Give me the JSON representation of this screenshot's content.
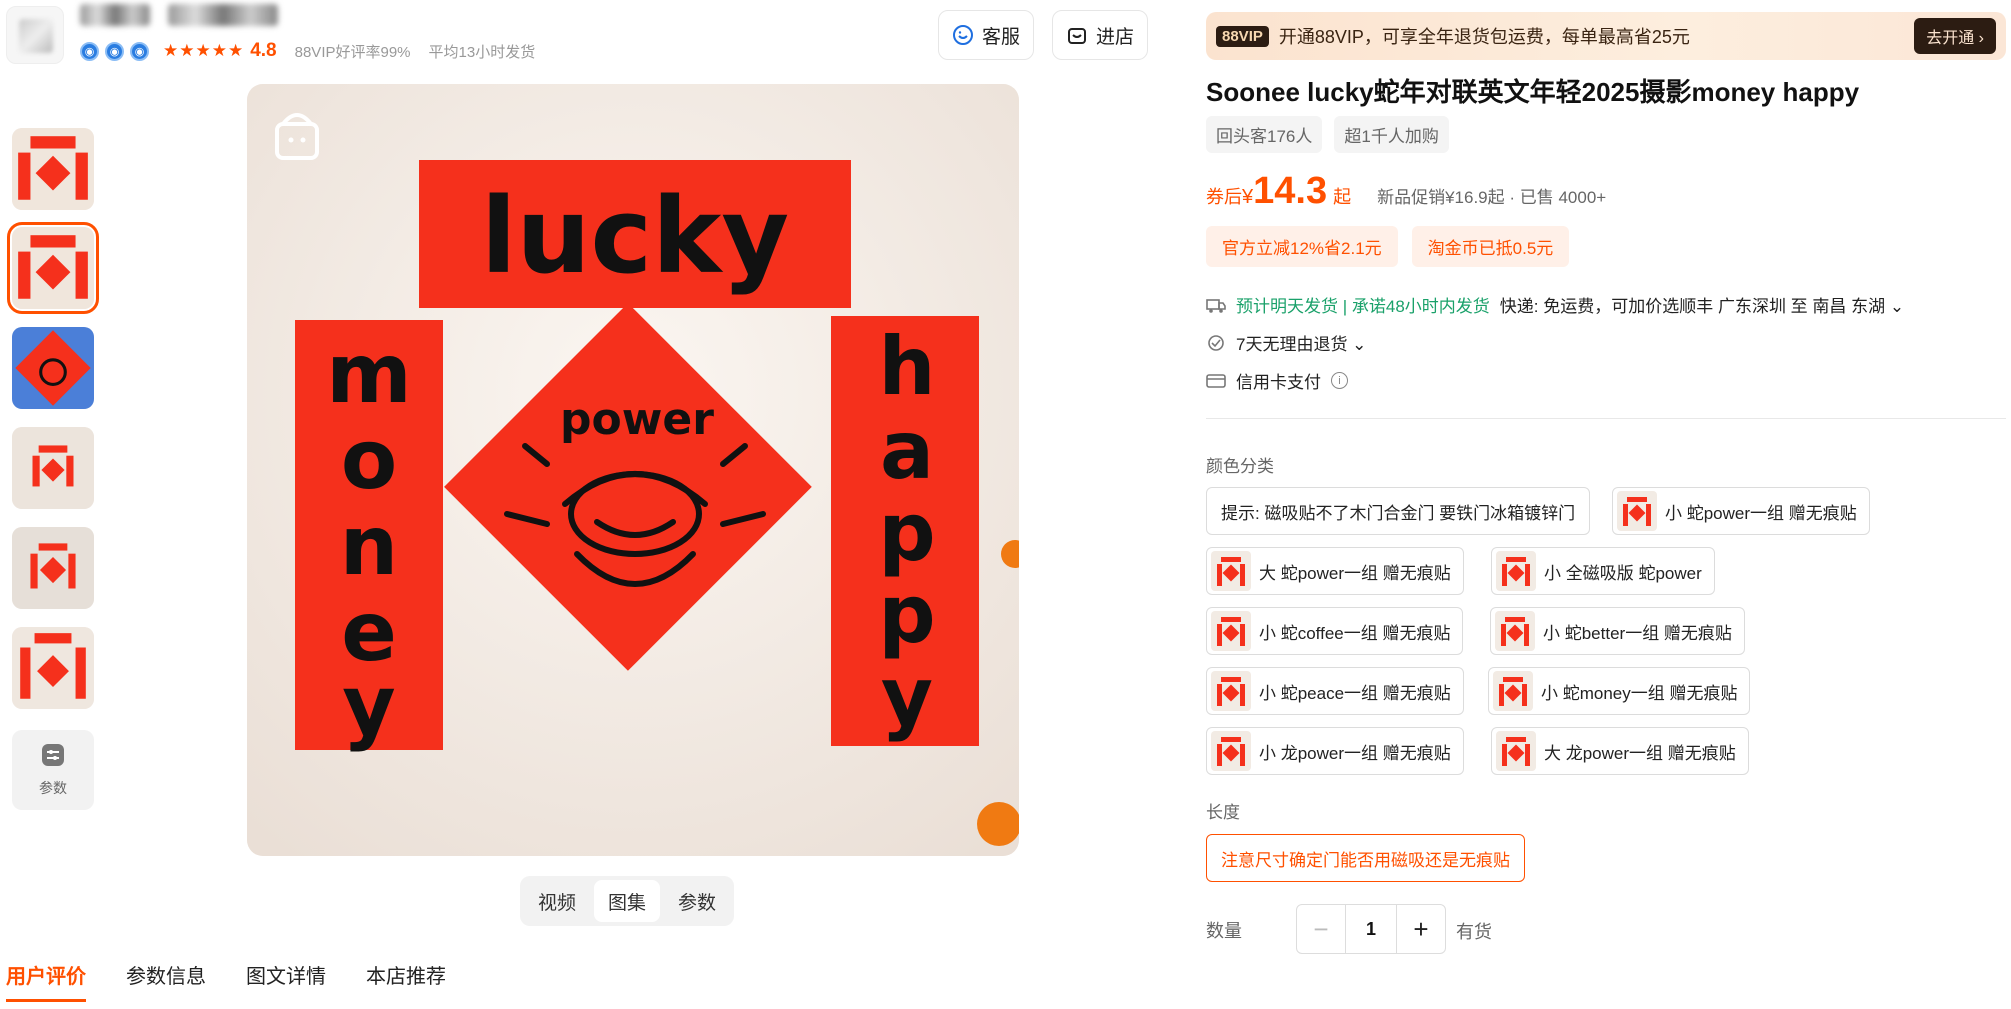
{
  "shop": {
    "rating": "4.8",
    "vip_rate": "88VIP好评率99%",
    "ship_time": "平均13小时发货"
  },
  "header": {
    "service_label": "客服",
    "enter_shop_label": "进店"
  },
  "thumbs_param_label": "参数",
  "main_image": {
    "top_text": "lucky",
    "left_text": "money",
    "right_text": "happy",
    "center_text": "power"
  },
  "media_tabs": [
    "视频",
    "图集",
    "参数"
  ],
  "bottom_tabs": [
    "用户评价",
    "参数信息",
    "图文详情",
    "本店推荐"
  ],
  "vip": {
    "tag": "88VIP",
    "text": "开通88VIP，可享全年退货包运费，每单最高省25元",
    "button": "去开通 ›"
  },
  "product": {
    "title": "Soonee lucky蛇年对联英文年轻2025摄影money happy",
    "tags": [
      "回头客176人",
      "超1千人加购"
    ]
  },
  "price": {
    "prefix": "券后",
    "currency": "¥",
    "value": "14.3",
    "suffix": "起",
    "extra": "新品促销¥16.9起 · 已售 4000+"
  },
  "promos": [
    "官方立减12%省2.1元",
    "淘金币已抵0.5元"
  ],
  "services": {
    "shipping_green": "预计明天发货 | 承诺48小时内发货",
    "shipping_rest": "快递: 免运费，可加价选顺丰  广东深圳 至 南昌 东湖 ⌄",
    "returns": "7天无理由退货 ⌄",
    "payment": "信用卡支付"
  },
  "color_label": "颜色分类",
  "colors": [
    "提示: 磁吸贴不了木门合金门 要铁门冰箱镀锌门",
    "小 蛇power一组 赠无痕贴",
    "大 蛇power一组 赠无痕贴",
    "小 全磁吸版 蛇power",
    "小 蛇coffee一组 赠无痕贴",
    "小 蛇better一组 赠无痕贴",
    "小 蛇peace一组 赠无痕贴",
    "小 蛇money一组 赠无痕贴",
    "小 龙power一组 赠无痕贴",
    "大 龙power一组 赠无痕贴"
  ],
  "length_label": "长度",
  "length_option": "注意尺寸确定门能否用磁吸还是无痕贴",
  "qty": {
    "label": "数量",
    "value": "1",
    "stock": "有货"
  },
  "colors_theme": {
    "accent": "#ff5000",
    "green": "#1aa16a",
    "couplet_red": "#f5301c"
  }
}
